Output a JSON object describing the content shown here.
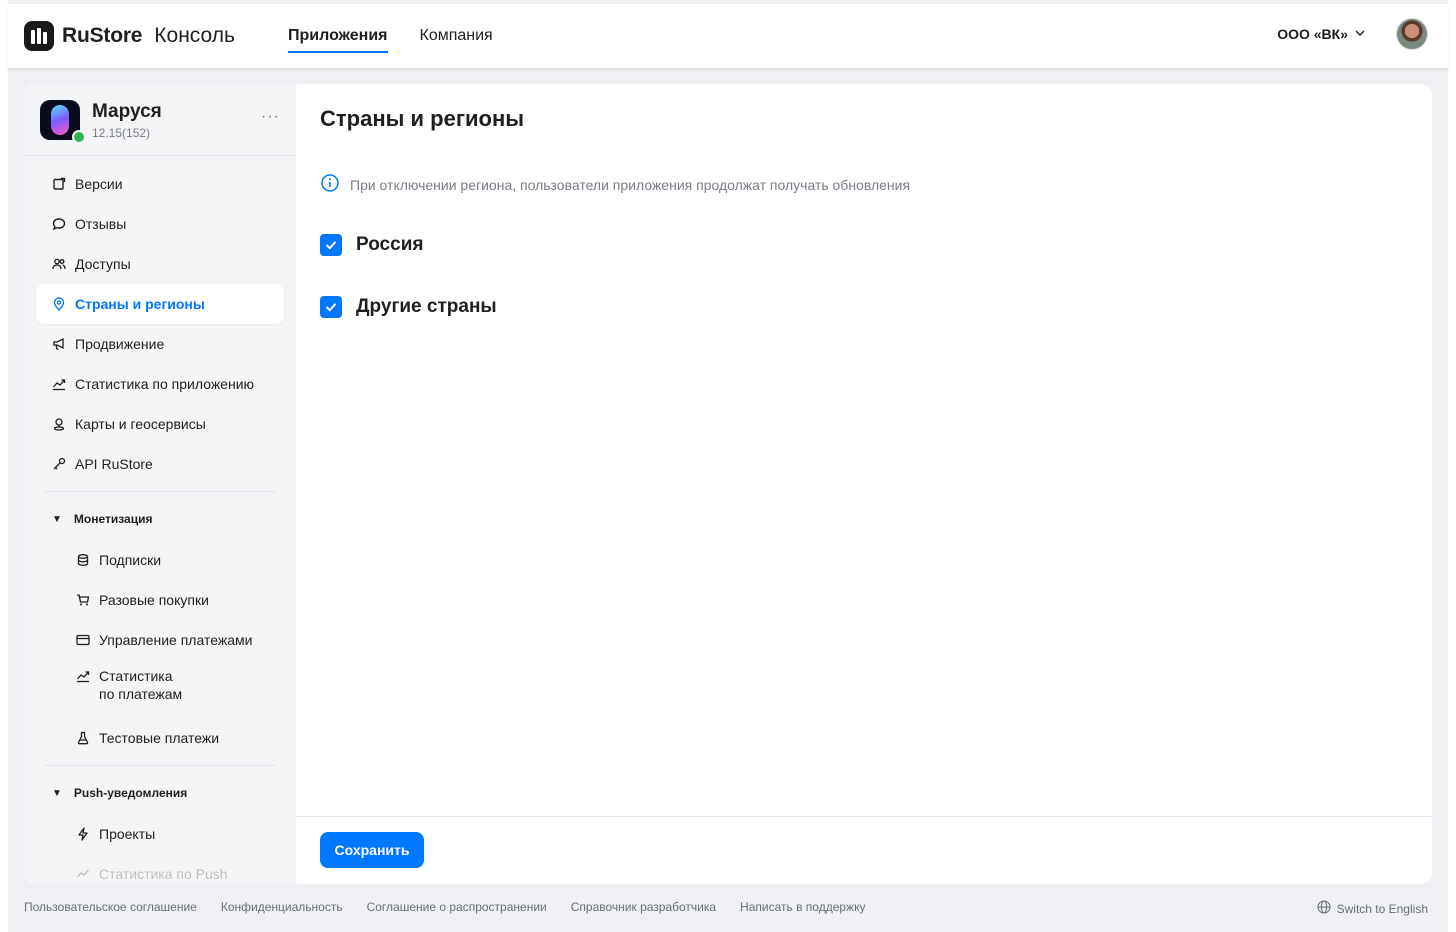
{
  "header": {
    "logo_brand": "RuStore",
    "logo_product": "Консоль",
    "tabs": [
      {
        "label": "Приложения",
        "active": true
      },
      {
        "label": "Компания",
        "active": false
      }
    ],
    "org_label": "ООО «ВК»"
  },
  "app": {
    "name": "Маруся",
    "version": "12.15(152)",
    "more": "···"
  },
  "sidebar": {
    "items": [
      {
        "label": "Версии",
        "icon": "versions-icon"
      },
      {
        "label": "Отзывы",
        "icon": "chat-bubble-icon"
      },
      {
        "label": "Доступы",
        "icon": "users-icon"
      },
      {
        "label": "Страны и регионы",
        "icon": "location-pin-icon",
        "active": true
      },
      {
        "label": "Продвижение",
        "icon": "megaphone-icon"
      },
      {
        "label": "Статистика по приложению",
        "icon": "trend-chart-icon"
      },
      {
        "label": "Карты и геосервисы",
        "icon": "map-pin-icon"
      },
      {
        "label": "API RuStore",
        "icon": "key-icon"
      }
    ],
    "monetization": {
      "title": "Монетизация",
      "items": [
        {
          "label": "Подписки",
          "icon": "database-icon"
        },
        {
          "label": "Разовые покупки",
          "icon": "cart-icon"
        },
        {
          "label": "Управление платежами",
          "icon": "card-icon"
        },
        {
          "label": "Статистика\nпо платежам",
          "icon": "trend-chart-icon"
        },
        {
          "label": "Тестовые платежи",
          "icon": "flask-icon"
        }
      ]
    },
    "push": {
      "title": "Push-уведомления",
      "items": [
        {
          "label": "Проекты",
          "icon": "lightning-icon"
        },
        {
          "label": "Статистика по Push",
          "icon": "trend-chart-icon"
        }
      ]
    }
  },
  "main": {
    "title": "Страны и регионы",
    "info_text": "При отключении региона, пользователи приложения продолжат получать обновления",
    "regions": [
      {
        "label": "Россия",
        "checked": true
      },
      {
        "label": "Другие страны",
        "checked": true
      }
    ],
    "save_label": "Сохранить"
  },
  "footer": {
    "links": [
      "Пользовательское соглашение",
      "Конфиденциальность",
      "Соглашение о распространении",
      "Справочник разработчика",
      "Написать в поддержку"
    ],
    "lang_switch": "Switch to English"
  },
  "colors": {
    "accent": "#0077ff",
    "sidebar_bg": "#f4f5f7",
    "page_bg": "#eff0f3",
    "online_status": "#2db84d"
  }
}
